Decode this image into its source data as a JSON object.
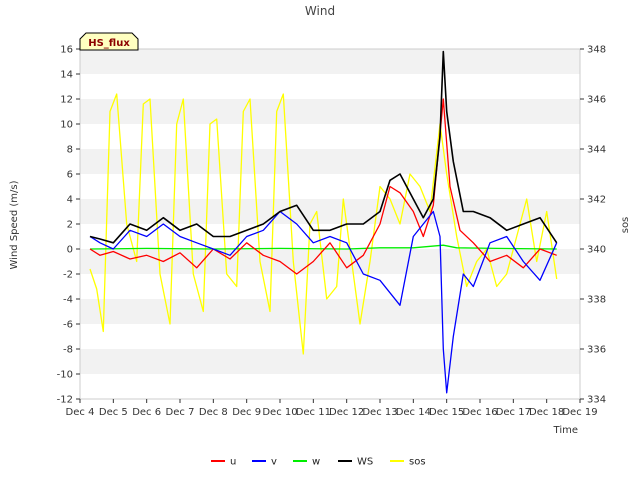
{
  "chart_data": {
    "type": "line",
    "title": "Wind",
    "xlabel": "Time",
    "ylabel": "Wind Speed (m/s)",
    "y2label": "sos",
    "badge": "HS_flux",
    "x_ticks": [
      "Dec 4",
      "Dec 5",
      "Dec 6",
      "Dec 7",
      "Dec 8",
      "Dec 9",
      "Dec 10",
      "Dec 11",
      "Dec 12",
      "Dec 13",
      "Dec 14",
      "Dec 15",
      "Dec 16",
      "Dec 17",
      "Dec 18",
      "Dec 19"
    ],
    "xlim": [
      0,
      15
    ],
    "ylim": [
      -12,
      16
    ],
    "y_ticks": [
      -12,
      -10,
      -8,
      -6,
      -4,
      -2,
      0,
      2,
      4,
      6,
      8,
      10,
      12,
      14,
      16
    ],
    "y2lim": [
      334,
      348
    ],
    "y2_ticks": [
      334,
      336,
      338,
      340,
      342,
      344,
      346,
      348
    ],
    "grid": "horizontal-bands",
    "legend_position": "bottom-center",
    "series": [
      {
        "name": "u",
        "axis": "left",
        "color": "#ff0000",
        "x": [
          0.3,
          0.6,
          1.0,
          1.5,
          2.0,
          2.5,
          3.0,
          3.5,
          4.0,
          4.5,
          5.0,
          5.5,
          6.0,
          6.5,
          7.0,
          7.5,
          8.0,
          8.5,
          9.0,
          9.3,
          9.6,
          10.0,
          10.3,
          10.6,
          10.9,
          11.1,
          11.4,
          11.8,
          12.3,
          12.8,
          13.3,
          13.8,
          14.3
        ],
        "y": [
          0.0,
          -0.5,
          -0.2,
          -0.8,
          -0.5,
          -1.0,
          -0.3,
          -1.5,
          0.0,
          -0.8,
          0.5,
          -0.5,
          -1.0,
          -2.0,
          -1.0,
          0.5,
          -1.5,
          -0.5,
          2.0,
          5.0,
          4.5,
          3.0,
          1.0,
          3.5,
          12.0,
          5.0,
          1.5,
          0.5,
          -1.0,
          -0.5,
          -1.5,
          0.0,
          -0.5
        ]
      },
      {
        "name": "v",
        "axis": "left",
        "color": "#0000ff",
        "x": [
          0.3,
          0.6,
          1.0,
          1.5,
          2.0,
          2.5,
          3.0,
          3.5,
          4.0,
          4.5,
          5.0,
          5.5,
          6.0,
          6.5,
          7.0,
          7.5,
          8.0,
          8.5,
          9.0,
          9.3,
          9.6,
          10.0,
          10.3,
          10.6,
          10.8,
          10.9,
          11.0,
          11.2,
          11.5,
          11.8,
          12.3,
          12.8,
          13.3,
          13.8,
          14.3
        ],
        "y": [
          1.0,
          0.5,
          0.0,
          1.5,
          1.0,
          2.0,
          1.0,
          0.5,
          0.0,
          -0.5,
          1.0,
          1.5,
          3.0,
          2.0,
          0.5,
          1.0,
          0.5,
          -2.0,
          -2.5,
          -3.5,
          -4.5,
          1.0,
          2.0,
          3.0,
          1.0,
          -8.0,
          -11.5,
          -7.0,
          -2.0,
          -3.0,
          0.5,
          1.0,
          -1.0,
          -2.5,
          0.5
        ]
      },
      {
        "name": "w",
        "axis": "left",
        "color": "#00ee00",
        "x": [
          0.3,
          2.0,
          4.0,
          6.0,
          8.0,
          9.0,
          10.0,
          10.9,
          11.3,
          12.5,
          14.3
        ],
        "y": [
          0.0,
          0.05,
          0.0,
          0.05,
          0.0,
          0.1,
          0.1,
          0.3,
          0.1,
          0.05,
          0.0
        ]
      },
      {
        "name": "WS",
        "axis": "left",
        "color": "#000000",
        "x": [
          0.3,
          0.6,
          1.0,
          1.5,
          2.0,
          2.5,
          3.0,
          3.5,
          4.0,
          4.5,
          5.0,
          5.5,
          6.0,
          6.5,
          7.0,
          7.5,
          8.0,
          8.5,
          9.0,
          9.3,
          9.6,
          10.0,
          10.3,
          10.6,
          10.8,
          10.9,
          11.0,
          11.2,
          11.5,
          11.8,
          12.3,
          12.8,
          13.3,
          13.8,
          14.3
        ],
        "y": [
          1.0,
          0.8,
          0.5,
          2.0,
          1.5,
          2.5,
          1.5,
          2.0,
          1.0,
          1.0,
          1.5,
          2.0,
          3.0,
          3.5,
          1.5,
          1.5,
          2.0,
          2.0,
          3.0,
          5.5,
          6.0,
          4.0,
          2.5,
          4.0,
          9.0,
          15.8,
          11.0,
          7.0,
          3.0,
          3.0,
          2.5,
          1.5,
          2.0,
          2.5,
          0.5
        ]
      },
      {
        "name": "sos",
        "axis": "right",
        "color": "#ffff00",
        "x": [
          0.3,
          0.5,
          0.7,
          0.9,
          1.1,
          1.4,
          1.7,
          1.9,
          2.1,
          2.4,
          2.7,
          2.9,
          3.1,
          3.4,
          3.7,
          3.9,
          4.1,
          4.4,
          4.7,
          4.9,
          5.1,
          5.4,
          5.7,
          5.9,
          6.1,
          6.4,
          6.7,
          6.9,
          7.1,
          7.4,
          7.7,
          7.9,
          8.1,
          8.4,
          8.7,
          9.0,
          9.3,
          9.6,
          9.9,
          10.2,
          10.5,
          10.8,
          11.0,
          11.3,
          11.6,
          11.9,
          12.2,
          12.5,
          12.8,
          13.1,
          13.4,
          13.7,
          14.0,
          14.3
        ],
        "y": [
          339.2,
          338.4,
          336.7,
          345.5,
          346.2,
          341.0,
          339.5,
          345.8,
          346.0,
          339.0,
          337.0,
          345.0,
          346.0,
          339.0,
          337.5,
          345.0,
          345.2,
          339.0,
          338.5,
          345.5,
          346.0,
          339.5,
          337.5,
          345.5,
          346.2,
          339.5,
          335.8,
          341.0,
          341.5,
          338.0,
          338.5,
          342.0,
          340.0,
          337.0,
          339.5,
          342.5,
          342.0,
          341.0,
          343.0,
          342.5,
          341.5,
          345.0,
          343.0,
          340.5,
          338.5,
          339.5,
          340.0,
          338.5,
          339.0,
          340.5,
          342.0,
          339.5,
          341.5,
          338.8
        ]
      }
    ]
  }
}
